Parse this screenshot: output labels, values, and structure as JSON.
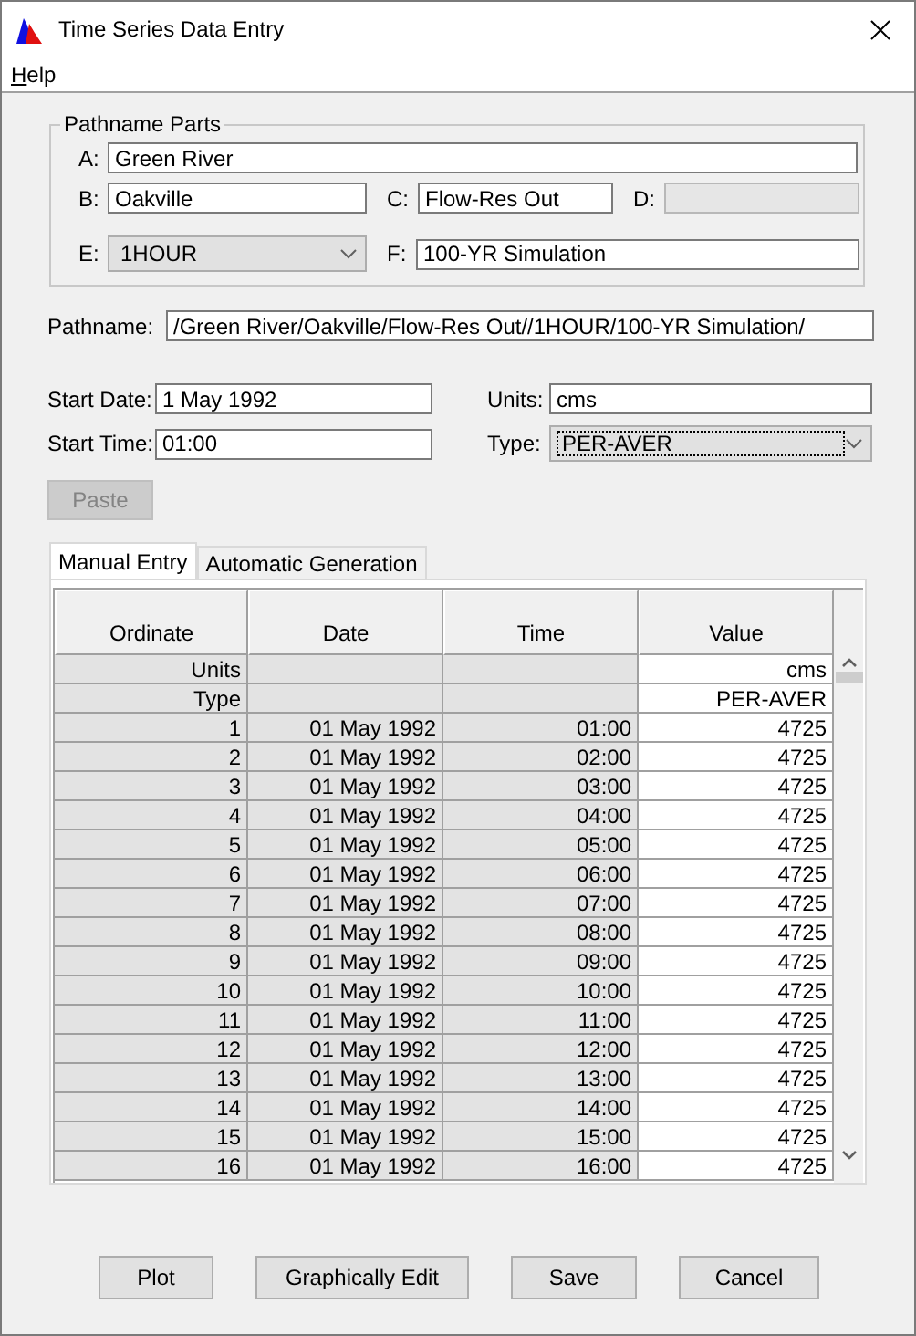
{
  "window": {
    "title": "Time Series Data Entry"
  },
  "menu": [
    "Help"
  ],
  "pathname_parts": {
    "legend": "Pathname Parts",
    "fields": [
      {
        "label": "A:",
        "value": "Green River",
        "kind": "text"
      },
      {
        "label": "B:",
        "value": "Oakville",
        "kind": "text"
      },
      {
        "label": "C:",
        "value": "Flow-Res Out",
        "kind": "text"
      },
      {
        "label": "D:",
        "kind": "text",
        "disabled": true
      },
      {
        "label": "E:",
        "value": "1HOUR",
        "kind": "dropdown"
      },
      {
        "label": "F:",
        "value": "100-YR Simulation",
        "kind": "text"
      }
    ]
  },
  "pathname": {
    "label": "Pathname:",
    "value": "/Green River/Oakville/Flow-Res Out//1HOUR/100-YR Simulation/"
  },
  "start_date": {
    "label": "Start Date:",
    "value": "1 May 1992"
  },
  "start_time": {
    "label": "Start Time:",
    "value": "01:00"
  },
  "units": {
    "label": "Units:",
    "value": "cms"
  },
  "type": {
    "label": "Type:",
    "value": "PER-AVER",
    "focused": true
  },
  "paste_button": {
    "label": "Paste",
    "disabled": true
  },
  "tabs": [
    {
      "label": "Manual Entry",
      "selected": true
    },
    {
      "label": "Automatic Generation",
      "selected": false
    }
  ],
  "table": {
    "columns": [
      "Ordinate",
      "Date",
      "Time",
      "Value"
    ],
    "rows": [
      {
        "kind": "meta",
        "label": "Units",
        "value": "cms"
      },
      {
        "kind": "meta",
        "label": "Type",
        "value": "PER-AVER"
      },
      {
        "kind": "data",
        "ordinate": "1",
        "date": "01 May 1992",
        "time": "01:00",
        "value": "4725"
      },
      {
        "kind": "data",
        "ordinate": "2",
        "date": "01 May 1992",
        "time": "02:00",
        "value": "4725"
      },
      {
        "kind": "data",
        "ordinate": "3",
        "date": "01 May 1992",
        "time": "03:00",
        "value": "4725"
      },
      {
        "kind": "data",
        "ordinate": "4",
        "date": "01 May 1992",
        "time": "04:00",
        "value": "4725"
      },
      {
        "kind": "data",
        "ordinate": "5",
        "date": "01 May 1992",
        "time": "05:00",
        "value": "4725"
      },
      {
        "kind": "data",
        "ordinate": "6",
        "date": "01 May 1992",
        "time": "06:00",
        "value": "4725"
      },
      {
        "kind": "data",
        "ordinate": "7",
        "date": "01 May 1992",
        "time": "07:00",
        "value": "4725"
      },
      {
        "kind": "data",
        "ordinate": "8",
        "date": "01 May 1992",
        "time": "08:00",
        "value": "4725"
      },
      {
        "kind": "data",
        "ordinate": "9",
        "date": "01 May 1992",
        "time": "09:00",
        "value": "4725"
      },
      {
        "kind": "data",
        "ordinate": "10",
        "date": "01 May 1992",
        "time": "10:00",
        "value": "4725"
      },
      {
        "kind": "data",
        "ordinate": "11",
        "date": "01 May 1992",
        "time": "11:00",
        "value": "4725"
      },
      {
        "kind": "data",
        "ordinate": "12",
        "date": "01 May 1992",
        "time": "12:00",
        "value": "4725"
      },
      {
        "kind": "data",
        "ordinate": "13",
        "date": "01 May 1992",
        "time": "13:00",
        "value": "4725"
      },
      {
        "kind": "data",
        "ordinate": "14",
        "date": "01 May 1992",
        "time": "14:00",
        "value": "4725"
      },
      {
        "kind": "data",
        "ordinate": "15",
        "date": "01 May 1992",
        "time": "15:00",
        "value": "4725"
      },
      {
        "kind": "data",
        "ordinate": "16",
        "date": "01 May 1992",
        "time": "16:00",
        "value": "4725"
      }
    ]
  },
  "buttons": [
    "Plot",
    "Graphically Edit",
    "Save",
    "Cancel"
  ]
}
